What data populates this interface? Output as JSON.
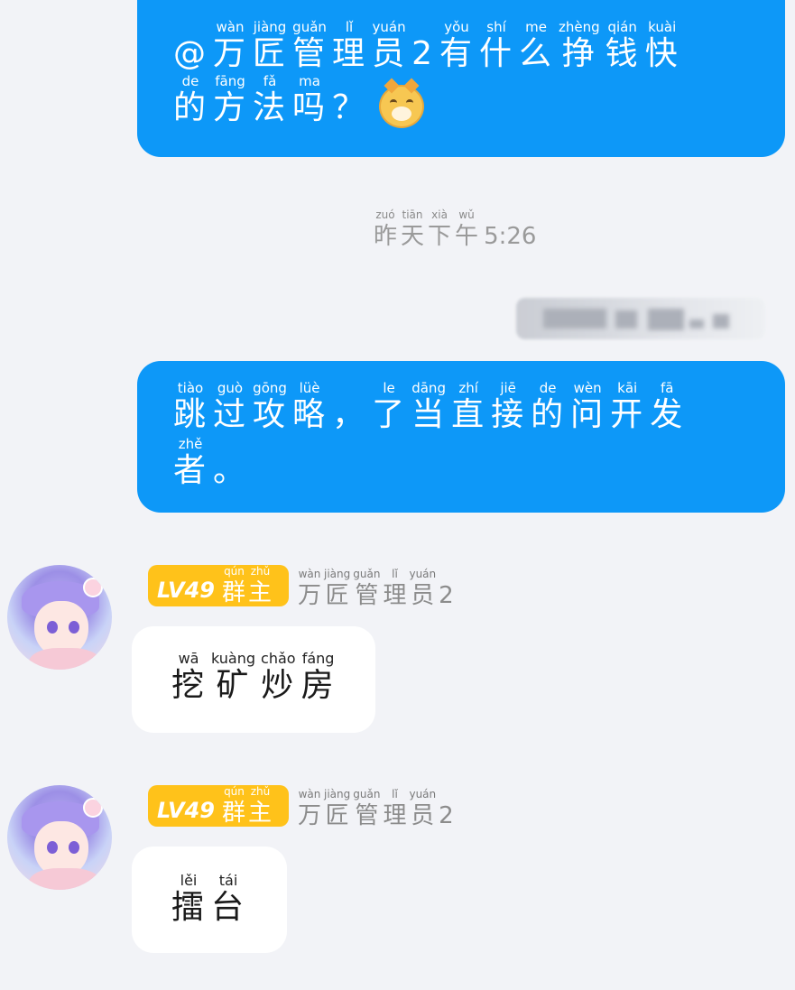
{
  "messages": [
    {
      "type": "outgoing",
      "lines": [
        [
          {
            "h": "@"
          },
          {
            "p": "wàn",
            "h": "万"
          },
          {
            "p": "jiàng",
            "h": "匠"
          },
          {
            "p": "guǎn",
            "h": "管"
          },
          {
            "p": "lǐ",
            "h": "理"
          },
          {
            "p": "yuán",
            "h": "员"
          },
          {
            "h": "2"
          },
          {
            "p": "yǒu",
            "h": "有"
          },
          {
            "p": "shí",
            "h": "什"
          },
          {
            "p": "me",
            "h": "么"
          },
          {
            "p": "zhèng",
            "h": "挣"
          },
          {
            "p": "qián",
            "h": "钱"
          },
          {
            "p": "kuài",
            "h": "快"
          }
        ],
        [
          {
            "p": "de",
            "h": "的"
          },
          {
            "p": "fāng",
            "h": "方"
          },
          {
            "p": "fǎ",
            "h": "法"
          },
          {
            "p": "ma",
            "h": "吗"
          },
          {
            "h": "？"
          }
        ]
      ],
      "emoji": "doge-emoji"
    },
    {
      "type": "outgoing",
      "lines": [
        [
          {
            "p": "tiào",
            "h": "跳"
          },
          {
            "p": "guò",
            "h": "过"
          },
          {
            "p": "gōng",
            "h": "攻"
          },
          {
            "p": "lüè",
            "h": "略"
          },
          {
            "h": "，"
          },
          {
            "p": "le",
            "h": "了"
          },
          {
            "p": "dāng",
            "h": "当"
          },
          {
            "p": "zhí",
            "h": "直"
          },
          {
            "p": "jiē",
            "h": "接"
          },
          {
            "p": "de",
            "h": "的"
          },
          {
            "p": "wèn",
            "h": "问"
          },
          {
            "p": "kāi",
            "h": "开"
          },
          {
            "p": "fā",
            "h": "发"
          }
        ],
        [
          {
            "p": "zhě",
            "h": "者"
          },
          {
            "h": "。"
          }
        ]
      ]
    },
    {
      "type": "incoming",
      "lines": [
        [
          {
            "p": "wā",
            "h": "挖"
          },
          {
            "p": "kuàng",
            "h": "矿"
          },
          {
            "p": "chǎo",
            "h": "炒"
          },
          {
            "p": "fáng",
            "h": "房"
          }
        ]
      ]
    },
    {
      "type": "incoming",
      "lines": [
        [
          {
            "p": "lěi",
            "h": "擂"
          },
          {
            "p": "tái",
            "h": "台"
          }
        ]
      ]
    }
  ],
  "timestamp": {
    "ruby": [
      {
        "p": "zuó",
        "h": "昨"
      },
      {
        "p": "tiān",
        "h": "天"
      },
      {
        "p": "xià",
        "h": "下"
      },
      {
        "p": "wǔ",
        "h": "午"
      }
    ],
    "time": "5:26"
  },
  "sender": {
    "level": "LV49",
    "role_ruby": [
      {
        "p": "qún",
        "h": "群"
      },
      {
        "p": "zhǔ",
        "h": "主"
      }
    ],
    "name_ruby": [
      {
        "p": "wàn",
        "h": "万"
      },
      {
        "p": "jiàng",
        "h": "匠"
      },
      {
        "p": "guǎn",
        "h": "管"
      },
      {
        "p": "lǐ",
        "h": "理"
      },
      {
        "p": "yuán",
        "h": "员"
      }
    ],
    "name_suffix": "2"
  },
  "colors": {
    "outgoing_bubble": "#0d98f8",
    "incoming_bubble": "#ffffff",
    "background": "#f2f3f7",
    "badge": "#ffc21a"
  }
}
